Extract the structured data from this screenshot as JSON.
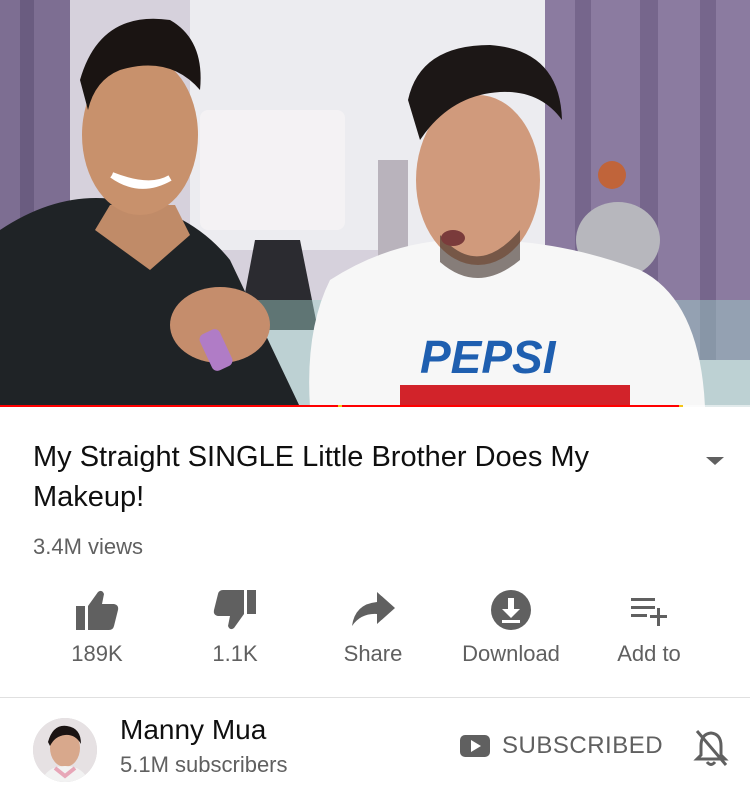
{
  "video": {
    "shirt_text": "PEPSI",
    "progress_fraction": 0.905,
    "buffered_fraction": 0.945,
    "chapter_markers": [
      0.45,
      0.905
    ]
  },
  "title": "My Straight SINGLE Little Brother Does My Makeup!",
  "views": "3.4M views",
  "actions": [
    {
      "icon": "thumbs-up-icon",
      "label": "189K"
    },
    {
      "icon": "thumbs-down-icon",
      "label": "1.1K"
    },
    {
      "icon": "share-icon",
      "label": "Share"
    },
    {
      "icon": "download-icon",
      "label": "Download"
    },
    {
      "icon": "add-to-playlist-icon",
      "label": "Add to"
    }
  ],
  "channel": {
    "name": "Manny Mua",
    "subscribers": "5.1M subscribers",
    "subscribe_label": "SUBSCRIBED"
  },
  "colors": {
    "progress": "#ff0000",
    "icon": "#606060",
    "text": "#0f0f0f",
    "secondary_text": "#606060"
  }
}
